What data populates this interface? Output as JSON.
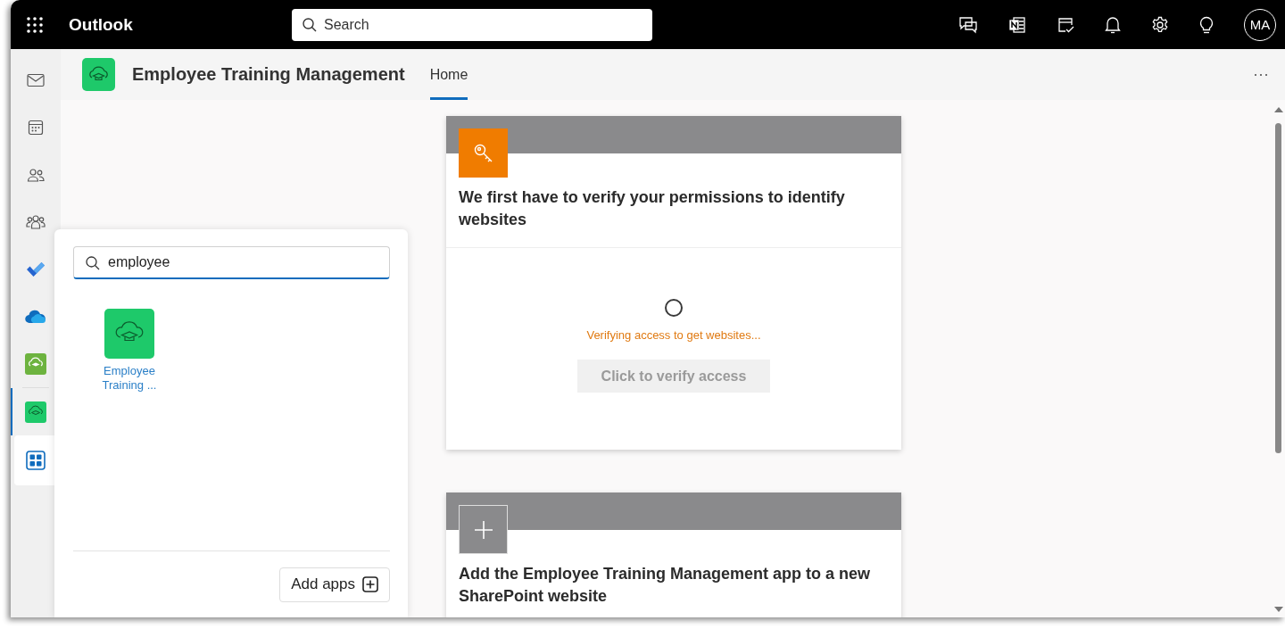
{
  "app_bar": {
    "product": "Outlook",
    "search": {
      "placeholder": "Search"
    },
    "avatar": "MA"
  },
  "rail": {
    "items": [
      {
        "kind": "mail",
        "selected": false
      },
      {
        "kind": "calendar",
        "selected": false
      },
      {
        "kind": "people",
        "selected": false
      },
      {
        "kind": "groups",
        "selected": false
      },
      {
        "kind": "todo",
        "selected": false
      },
      {
        "kind": "cloud",
        "selected": false
      },
      {
        "kind": "training-app-olive",
        "selected": false
      },
      {
        "kind": "training-app",
        "selected": true
      }
    ],
    "apps_button": {
      "expanded": true
    }
  },
  "header": {
    "app_title": "Employee Training Management",
    "tabs": [
      {
        "label": "Home",
        "selected": true
      }
    ]
  },
  "app_flyout": {
    "search": {
      "value": "employee"
    },
    "results": [
      {
        "name": "Employee Training ..."
      }
    ],
    "add_button": "Add apps"
  },
  "cards": [
    {
      "kind": "key",
      "title": "We first have to verify your permissions to identify websites",
      "status": "Verifying access to get websites...",
      "button": {
        "label": "Click to verify access",
        "disabled": true
      }
    },
    {
      "kind": "add",
      "title": "Add the Employee Training Management app to a new SharePoint website"
    }
  ]
}
